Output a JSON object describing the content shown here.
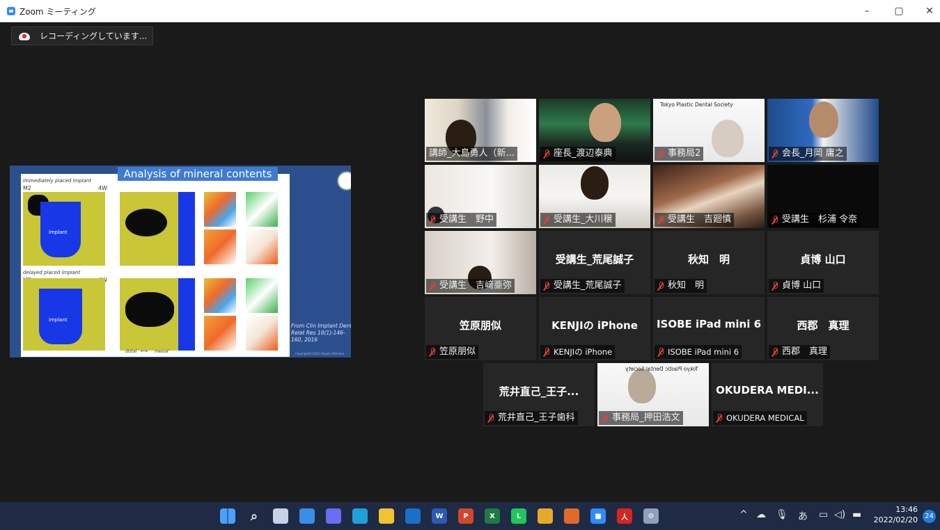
{
  "window": {
    "title": "Zoom ミーティング",
    "minimize": "–",
    "maximize": "▢",
    "close": "✕"
  },
  "recording": {
    "label": "レコーディングしています..."
  },
  "shared_slide": {
    "title": "Analysis of mineral contents",
    "caption_top": "Immediately placed implant",
    "caption_bottom": "delayed placed implant",
    "tag_m2_top": "M2",
    "tag_4w_top": "4W",
    "tag_m2_bottom": "M2",
    "tag_4w_bottom": "4W",
    "implant_top": "implant",
    "implant_bottom": "implant",
    "axis_distal": "distal",
    "axis_mesial": "mesial",
    "footnote": "From Clin Implant Dent Relat Res 18(1):146-160, 2016",
    "copyright": "Copyright(C)2022 Hayato Ohshima"
  },
  "participants": [
    {
      "name": "講師_大島勇人（新...",
      "muted": false,
      "video": true,
      "speaking": true
    },
    {
      "name": "座長_渡辺泰典",
      "muted": true,
      "video": true
    },
    {
      "name": "事務局2",
      "muted": true,
      "video": true,
      "banner": "Tokyo Plastic Dental Society"
    },
    {
      "name": "会長_月岡 庸之",
      "muted": true,
      "video": true
    },
    {
      "name": "受講生　野中",
      "muted": true,
      "video": true
    },
    {
      "name": "受講生_大川穣",
      "muted": true,
      "video": true
    },
    {
      "name": "受講生　吉廻慎",
      "muted": true,
      "video": true
    },
    {
      "name": "受講生　杉浦 令奈",
      "muted": true,
      "video": true
    },
    {
      "name": "受講生　吉﨑亜弥",
      "muted": true,
      "video": true
    },
    {
      "name": "受講生_荒尾誠子",
      "display": "受講生_荒尾誠子",
      "muted": true,
      "video": false
    },
    {
      "name": "秋知　明",
      "display": "秋知　明",
      "muted": true,
      "video": false
    },
    {
      "name": "貞博 山口",
      "display": "貞博 山口",
      "muted": true,
      "video": false
    },
    {
      "name": "笠原朋似",
      "display": "笠原朋似",
      "muted": true,
      "video": false
    },
    {
      "name": "KENJIの iPhone",
      "display": "KENJIの iPhone",
      "muted": true,
      "video": false
    },
    {
      "name": "ISOBE iPad mini 6",
      "display": "ISOBE iPad mini 6",
      "muted": true,
      "video": false
    },
    {
      "name": "西郡　真理",
      "display": "西郡　真理",
      "muted": true,
      "video": false
    },
    {
      "name": "荒井直己_王子歯科",
      "display": "荒井直己_王子...",
      "muted": true,
      "video": false
    },
    {
      "name": "事務局_押田浩文",
      "muted": true,
      "video": true,
      "banner": "Tokyo Plastic Dental Society"
    },
    {
      "name": "OKUDERA MEDICAL",
      "display": "OKUDERA MEDI...",
      "muted": true,
      "video": false
    }
  ],
  "taskbar": {
    "apps": [
      "start-icon",
      "search-icon",
      "task-view-icon",
      "widgets-icon",
      "chat-icon",
      "edge-icon",
      "file-explorer-icon",
      "outlook-icon",
      "word-icon",
      "powerpoint-icon",
      "excel-icon",
      "line-icon",
      "chrome-icon",
      "chrome-alt-icon",
      "zoom-icon",
      "acrobat-icon",
      "settings-icon"
    ],
    "ime": "あ",
    "time": "13:46",
    "date": "2022/02/20",
    "notifications": "24"
  },
  "colors": {
    "speaking_border": "#c6e35a",
    "muted_icon": "#e3413a",
    "taskbar": "#1f2a44",
    "slide_bg": "#2c4f8e"
  }
}
